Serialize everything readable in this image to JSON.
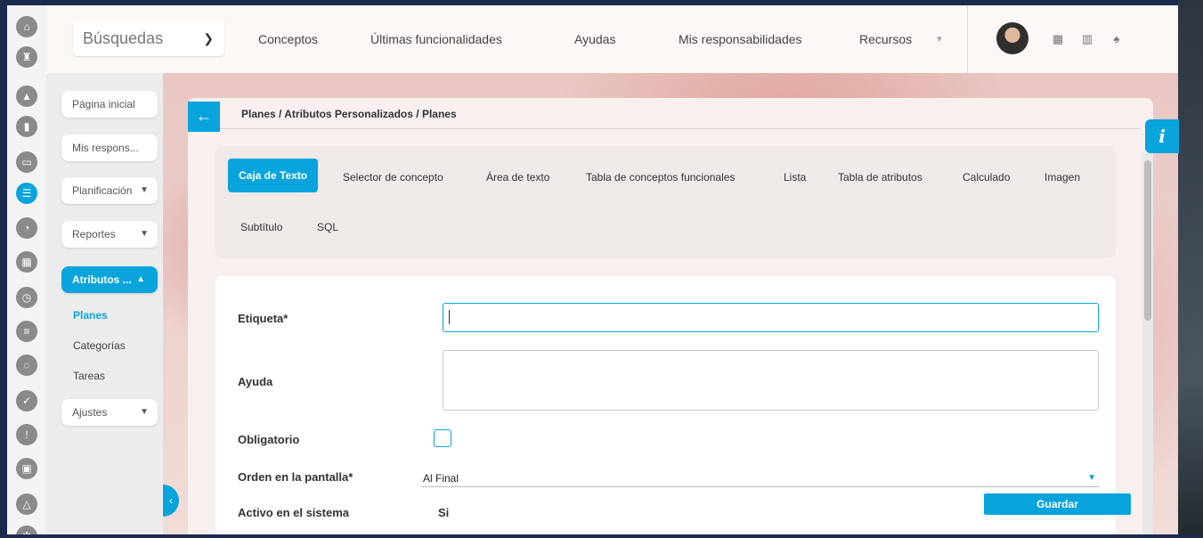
{
  "search": {
    "label": "Búsquedas"
  },
  "nav": {
    "items": [
      "Conceptos",
      "Últimas funcionalidades",
      "Ayudas",
      "Mis responsabilidades",
      "Recursos"
    ]
  },
  "sidebar": {
    "buttons": [
      "Página inicial",
      "Mis respons...",
      "Planificación",
      "Reportes",
      "Atributos ...",
      "Ajustes"
    ],
    "subitems": [
      "Planes",
      "Categorías",
      "Tareas"
    ]
  },
  "breadcrumb": "Planes / Atributos Personalizados / Planes",
  "tabs": [
    "Caja de Texto",
    "Selector de concepto",
    "Área de texto",
    "Tabla de conceptos funcionales",
    "Lista",
    "Tabla de atributos",
    "Calculado",
    "Imagen",
    "Subtítulo",
    "SQL"
  ],
  "form": {
    "etiqueta_label": "Etiqueta*",
    "ayuda_label": "Ayuda",
    "obligatorio_label": "Obligatorio",
    "orden_label": "Orden en la pantalla*",
    "orden_value": "Al Final",
    "activo_label": "Activo en el sistema",
    "activo_value": "Si",
    "save_label": "Guardar"
  },
  "info_label": "i",
  "colors": {
    "accent": "#0aa4dd"
  }
}
